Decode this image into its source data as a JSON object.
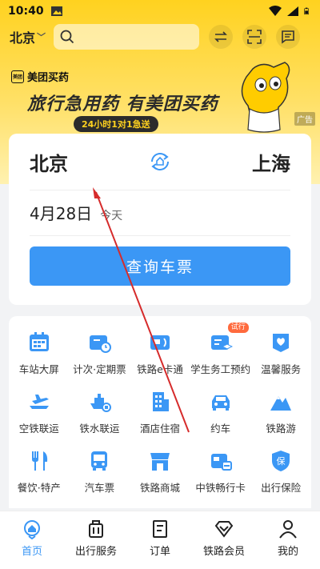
{
  "status_bar": {
    "time": "10:40"
  },
  "header": {
    "city": "北京",
    "search_placeholder": "",
    "icons": [
      "swap-icon",
      "scan-icon",
      "message-icon"
    ]
  },
  "banner": {
    "brand": "美团买药",
    "logo_text": "美团",
    "slogan": "旅行急用药 有美团买药",
    "pill": "24小时1对1急送",
    "ad_tag": "广告"
  },
  "ticket": {
    "from_station": "北京",
    "to_station": "上海",
    "date": "4月28日",
    "date_note": "今天",
    "query_label": "查询车票"
  },
  "services": {
    "items": [
      {
        "label": "车站大屏",
        "icon": "station-screen-icon"
      },
      {
        "label": "计次·定期票",
        "icon": "ticket-clock-icon"
      },
      {
        "label": "铁路e卡通",
        "icon": "ecard-icon"
      },
      {
        "label": "学生务工预约",
        "icon": "student-icon",
        "badge": "试行"
      },
      {
        "label": "温馨服务",
        "icon": "heart-service-icon"
      },
      {
        "label": "空铁联运",
        "icon": "air-rail-icon"
      },
      {
        "label": "铁水联运",
        "icon": "ship-rail-icon"
      },
      {
        "label": "酒店住宿",
        "icon": "hotel-icon"
      },
      {
        "label": "约车",
        "icon": "car-icon"
      },
      {
        "label": "铁路游",
        "icon": "mountain-icon"
      },
      {
        "label": "餐饮·特产",
        "icon": "dining-icon"
      },
      {
        "label": "汽车票",
        "icon": "bus-icon"
      },
      {
        "label": "铁路商城",
        "icon": "shop-icon"
      },
      {
        "label": "中铁畅行卡",
        "icon": "card-icon"
      },
      {
        "label": "出行保险",
        "icon": "insurance-icon"
      }
    ]
  },
  "bottom_nav": {
    "items": [
      {
        "label": "首页",
        "icon": "home-icon",
        "active": true
      },
      {
        "label": "出行服务",
        "icon": "luggage-icon"
      },
      {
        "label": "订单",
        "icon": "order-icon"
      },
      {
        "label": "铁路会员",
        "icon": "member-icon"
      },
      {
        "label": "我的",
        "icon": "profile-icon"
      }
    ]
  },
  "colors": {
    "accent": "#3b97f5",
    "brand_yellow": "#ffd21f",
    "annotation_red": "#d62b2b"
  }
}
